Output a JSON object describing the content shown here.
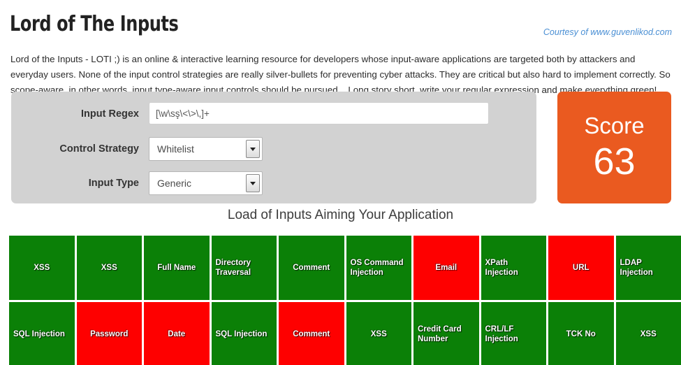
{
  "header": {
    "title": "Lord of The Inputs",
    "courtesy": "Courtesy of www.guvenlikod.com",
    "intro": "Lord of the Inputs - LOTI ;) is an online & interactive learning resource for developers whose input-aware applications are targeted both by attackers and everyday users. None of the input control strategies are really silver-bullets for preventing cyber attacks. They are critical but also hard to implement correctly. So scope-aware, in other words, input type-aware input controls should be pursued... Long story short, write your regular expression and make everything green!"
  },
  "form": {
    "regex": {
      "label": "Input Regex",
      "value": "[\\w\\sş\\<\\>\\,]+",
      "placeholder": ""
    },
    "control_strategy": {
      "label": "Control Strategy",
      "value": "Whitelist"
    },
    "input_type": {
      "label": "Input Type",
      "value": "Generic"
    }
  },
  "score": {
    "label": "Score",
    "value": "63",
    "color": "#ea5a20"
  },
  "grid": {
    "heading": "Load of Inputs Aiming Your Application",
    "colors": {
      "pass": "#0b8007",
      "fail": "#fe0000"
    },
    "cells": [
      {
        "label": "XSS",
        "status": "pass"
      },
      {
        "label": "XSS",
        "status": "pass"
      },
      {
        "label": "Full Name",
        "status": "pass"
      },
      {
        "label": "Directory Traversal",
        "status": "pass"
      },
      {
        "label": "Comment",
        "status": "pass"
      },
      {
        "label": "OS Command Injection",
        "status": "pass"
      },
      {
        "label": "Email",
        "status": "fail"
      },
      {
        "label": "XPath Injection",
        "status": "pass"
      },
      {
        "label": "URL",
        "status": "fail"
      },
      {
        "label": "LDAP Injection",
        "status": "pass"
      },
      {
        "label": "SQL Injection",
        "status": "pass"
      },
      {
        "label": "Password",
        "status": "fail"
      },
      {
        "label": "Date",
        "status": "fail"
      },
      {
        "label": "SQL Injection",
        "status": "pass"
      },
      {
        "label": "Comment",
        "status": "fail"
      },
      {
        "label": "XSS",
        "status": "pass"
      },
      {
        "label": "Credit Card Number",
        "status": "pass"
      },
      {
        "label": "CRL/LF Injection",
        "status": "pass"
      },
      {
        "label": "TCK No",
        "status": "pass"
      },
      {
        "label": "XSS",
        "status": "pass"
      }
    ]
  }
}
